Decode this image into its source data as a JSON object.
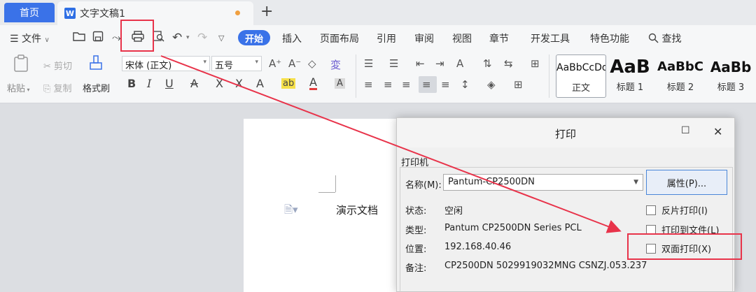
{
  "tabbar": {
    "home_label": "首页",
    "doc_icon_letter": "W",
    "doc_title": "文字文稿1",
    "add_tab": "+"
  },
  "menu": {
    "file_label": "文件",
    "tabs": [
      "开始",
      "插入",
      "页面布局",
      "引用",
      "审阅",
      "视图",
      "章节",
      "开发工具",
      "特色功能"
    ],
    "search_label": "查找"
  },
  "ribbon": {
    "paste_label": "粘贴",
    "cut_label": "剪切",
    "copy_label": "复制",
    "format_painter_label": "格式刷",
    "font_name": "宋体 (正文)",
    "font_size": "五号",
    "styles": [
      {
        "sample": "AaBbCcDd",
        "name": "正文"
      },
      {
        "sample": "AaB",
        "name": "标题 1"
      },
      {
        "sample": "AaBbC",
        "name": "标题 2"
      },
      {
        "sample": "AaBb",
        "name": "标题 3"
      }
    ]
  },
  "document": {
    "text": "演示文档"
  },
  "print_dialog": {
    "title": "打印",
    "group_label": "打印机",
    "name_label": "名称(M):",
    "printer_name": "Pantum-CP2500DN",
    "properties_button": "属性(P)...",
    "status_label": "状态:",
    "status_value": "空闲",
    "type_label": "类型:",
    "type_value": "Pantum CP2500DN Series PCL",
    "location_label": "位置:",
    "location_value": "192.168.40.46",
    "comment_label": "备注:",
    "comment_value": "CP2500DN 5029919032MNG CSNZJ.053.237",
    "reverse_print_label": "反片打印(I)",
    "print_to_file_label": "打印到文件(L)",
    "duplex_label": "双面打印(X)"
  },
  "colors": {
    "accent": "#3a72e8",
    "annotation": "#e8334a"
  }
}
